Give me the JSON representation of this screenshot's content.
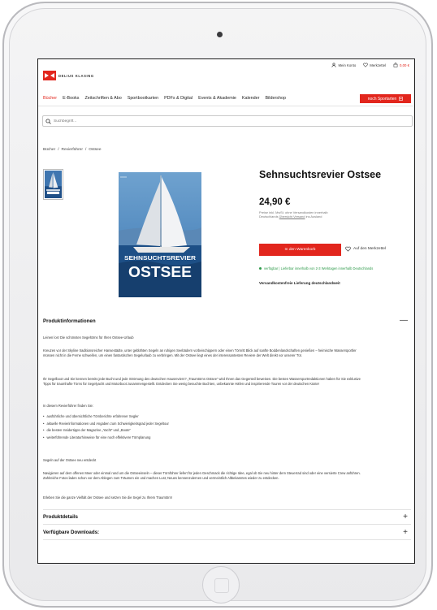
{
  "brand": {
    "name": "DELIUS KLASING",
    "accent": "#e2261d"
  },
  "top_links": {
    "account": "Mein Konto",
    "wishlist": "Merkzettel",
    "cart_amount": "0,00 €"
  },
  "nav": {
    "items": [
      "Bücher",
      "E-Books",
      "Zeitschriften & Abo",
      "Sportbootkarten",
      "PDFs & Digital",
      "Events & Akademie",
      "Kalender",
      "Bildershop"
    ],
    "cta": "noch Sportarten"
  },
  "search": {
    "placeholder": "Suchbegriff..."
  },
  "breadcrumb": [
    "Bücher",
    "/",
    "Revierführer",
    "/",
    "Ostsee"
  ],
  "product": {
    "cover_title": "SEHNSUCHTSREVIER",
    "cover_subtitle": "OSTSEE",
    "title": "Sehnsuchtsrevier Ostsee",
    "price": "24,90 €",
    "price_note": "Preise inkl. MwSt. ohne Versandkosten innerhalb Deutschlands",
    "price_note_link": "Übersicht Versand",
    "price_note_end": "ins Ausland",
    "add_to_cart": "In den Warenkorb",
    "add_to_wishlist": "Auf den Merkzettel",
    "availability": "verfügbar | Lieferbar innerhalb von 2-3 Werktagen innerhalb Deutschlands",
    "free_shipping": "Versandkostenfreie Lieferung deutschlandweit"
  },
  "sections": {
    "info_title": "Produktinformationen",
    "info_toggle": "—",
    "intro": "Leinen los! Die schönsten Segeltörns für Ihren Ostsee-Urlaub",
    "para1": "Kreuzen vor der Skyline traditionsreicher Hansestädte, unter geblähten Segeln an ruhigen Seebädern vorbeischippern oder einen Törnritt Blick auf sanfte Boddenlandschaften genießen – heimische Wassersportler müssen nicht in die Ferne schweifen, um einen fantastischen Segelurlaub zu verbringen. Mit der Ostsee liegt eines der interessantesten Reviere der Welt direkt vor unserer Tür.",
    "para2": "Ihr Segelboot und Sie kennen bereits jede Bucht und jede Strömung des deutschen Hausreviers? „Traumtörns Ostsee“ wird Ihnen das Gegenteil beweisen. Die besten Wassersportredaktionen haben für Sie exklusive Tipps für traumhafte Törns für Segelyacht und Motorboot zusammengestellt. Entdecken Sie wenig besuchte Buchten, unbekannte Häfen und inspirierende Touren vor der deutschen Küste!",
    "list_intro": "In diesem Revierführer finden Sie:",
    "bullets": [
      "ausführliche und übersichtliche Törnberichte erfahrener Segler",
      "aktuelle Revierinformationen und Angaben zum Schwierigkeitsgrad jeder Segeltour",
      "die besten Insidertipps der Magazine „Yacht“ und „Boote“",
      "weiterführende Literaturhinweise für eine noch effektivere Törnplanung"
    ],
    "sub_head": "Segeln auf der Ostsee neu entdeckt",
    "para3": "Navigieren auf dem offenen Meer oder einmal rund um die Ostseeinseln – dieser Törnführer liefert für jeden Geschmack die richtige Idee, egal ob Sie neu hinter dem Steuerrad sind oder eine versierte Crew anführen. Zahlreiche Fotos laden schon vor dem Ablegen zum Träumen ein und machen Lust, Neues kennenzulernen und vermeintlich Altbekanntes wieder zu entdecken.",
    "para4": "Erleben Sie die ganze Vielfalt der Ostsee und setzen Sie die Segel zu Ihrem Traumtörn!",
    "details_title": "Produktdetails",
    "downloads_title": "Verfügbare Downloads:",
    "plus": "+"
  }
}
